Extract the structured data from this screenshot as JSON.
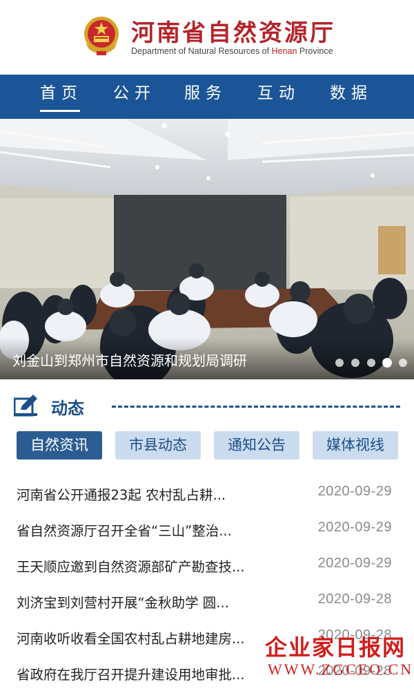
{
  "header": {
    "title_cn": "河南省自然资源厅",
    "title_en_prefix": "Department of Natural Resources of ",
    "title_en_highlight": "Henan",
    "title_en_suffix": " Province",
    "emblem_icon": "national-emblem-icon"
  },
  "nav": {
    "items": [
      {
        "label": "首页",
        "active": true
      },
      {
        "label": "公开",
        "active": false
      },
      {
        "label": "服务",
        "active": false
      },
      {
        "label": "互动",
        "active": false
      },
      {
        "label": "数据",
        "active": false
      }
    ]
  },
  "banner": {
    "caption": "刘金山到郑州市自然资源和规划局调研",
    "slides_total": 5,
    "active_slide": 4
  },
  "section": {
    "title": "动态",
    "icon": "edit-icon"
  },
  "tabs": [
    {
      "label": "自然资讯",
      "active": true
    },
    {
      "label": "市县动态",
      "active": false
    },
    {
      "label": "通知公告",
      "active": false
    },
    {
      "label": "媒体视线",
      "active": false
    }
  ],
  "news": [
    {
      "title": "河南省公开通报23起 农村乱占耕...",
      "date": "2020-09-29"
    },
    {
      "title": "省自然资源厅召开全省“三山”整治...",
      "date": "2020-09-29"
    },
    {
      "title": "王天顺应邀到自然资源部矿产勘查技...",
      "date": "2020-09-29"
    },
    {
      "title": "刘济宝到刘营村开展“金秋助学 圆...",
      "date": "2020-09-28"
    },
    {
      "title": "河南收听收看全国农村乱占耕地建房...",
      "date": "2020-09-28"
    },
    {
      "title": "省政府在我厅召开提升建设用地审批...",
      "date": "2020-09-28"
    }
  ],
  "watermark": {
    "name": "企业家日报网",
    "url": "WWW.ZGCEO.CN"
  },
  "colors": {
    "brand_red": "#b5232a",
    "nav_blue": "#1c5597",
    "tab_active": "#2c5d92",
    "tab_inactive": "#cbdcee",
    "watermark_red": "#d21d1d"
  }
}
